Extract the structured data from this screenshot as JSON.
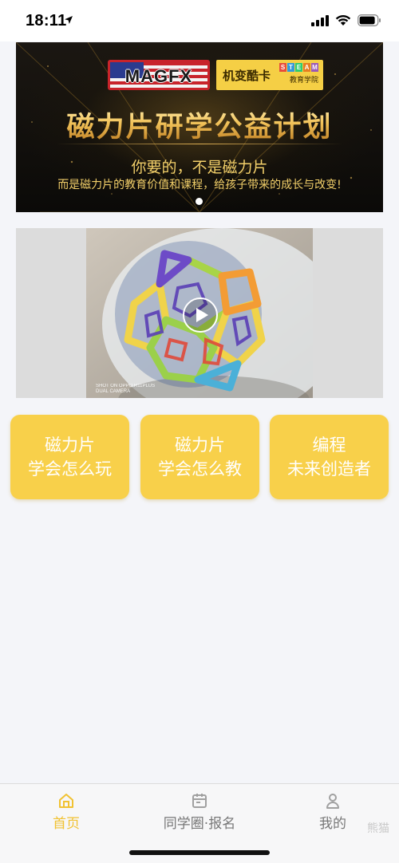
{
  "status_bar": {
    "time": "18:11",
    "icons": [
      "location-arrow-icon",
      "cellular-signal-icon",
      "wifi-icon",
      "battery-icon"
    ]
  },
  "banner": {
    "logo_text": "MAGFX",
    "brand_name": "机变酷卡",
    "steam_letters": [
      "S",
      "T",
      "E",
      "A",
      "M"
    ],
    "steam_colors": [
      "#e74c3c",
      "#3498db",
      "#2ecc71",
      "#e67e22",
      "#9b59b6"
    ],
    "steam_subtitle": "教育学院",
    "title": "磁力片研学公益计划",
    "subtitle_1": "你要的，不是磁力片",
    "subtitle_2": "而是磁力片的教育价值和课程，给孩子带来的成长与改变!",
    "pagination": {
      "current": 1,
      "total": 1
    }
  },
  "video": {
    "watermark_line1": "SHOT ON OPPO R11PLUS",
    "watermark_line2": "DUAL CAMERA",
    "play_icon": "play-icon"
  },
  "cards": [
    {
      "line1": "磁力片",
      "line2": "学会怎么玩"
    },
    {
      "line1": "磁力片",
      "line2": "学会怎么教"
    },
    {
      "line1": "编程",
      "line2": "未来创造者"
    }
  ],
  "tabs": [
    {
      "label": "首页",
      "icon": "home-icon",
      "active": true
    },
    {
      "label": "同学圈·报名",
      "icon": "signup-card-icon",
      "active": false
    },
    {
      "label": "我的",
      "icon": "person-icon",
      "active": false
    }
  ],
  "watermark": "熊猫",
  "colors": {
    "accent": "#f8d04a",
    "active_tab": "#f1c232",
    "inactive_tab": "#777777",
    "page_bg": "#f4f5f9"
  }
}
